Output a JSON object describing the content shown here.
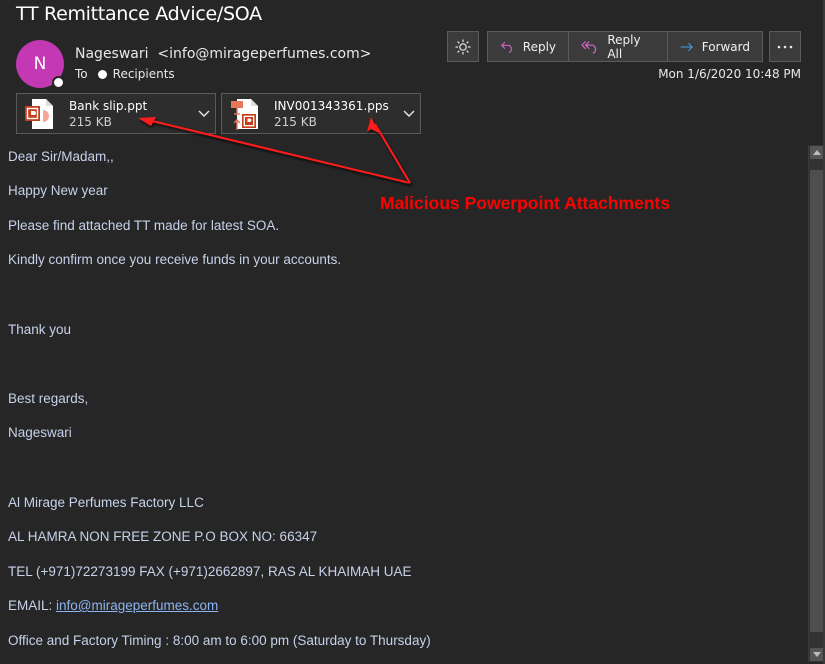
{
  "email": {
    "subject": "TT Remittance Advice/SOA",
    "avatar_initial": "N",
    "sender_display": "Nageswari  <info@mirageperfumes.com>",
    "to_label": "To",
    "recipients_label": "Recipients",
    "date": "Mon 1/6/2020 10:48 PM"
  },
  "toolbar": {
    "theme_icon": "sun-icon",
    "reply_label": "Reply",
    "reply_all_label": "Reply All",
    "forward_label": "Forward",
    "more_icon": "more-icon",
    "colors": {
      "reply_arrow": "#d269c8",
      "forward_arrow": "#4aa0e6"
    }
  },
  "attachments": [
    {
      "name": "Bank slip.ppt",
      "size": "215 KB",
      "icon": "powerpoint-file-icon"
    },
    {
      "name": "INV001343361.pps",
      "size": "215 KB",
      "icon": "powerpoint-show-file-icon"
    }
  ],
  "body": {
    "lines": [
      "Dear Sir/Madam,,",
      "Happy New year",
      "Please find attached TT made for latest SOA.",
      "Kindly confirm once you receive funds in your accounts.",
      "Thank you",
      "Best regards,",
      "Nageswari",
      "Al Mirage Perfumes Factory LLC",
      "AL HAMRA NON FREE ZONE P.O BOX NO: 66347",
      "TEL (+971)72273199 FAX (+971)2662897, RAS AL KHAIMAH UAE"
    ],
    "email_label": "EMAIL: ",
    "email_link": "info@mirageperfumes.com",
    "timing": "Office and Factory Timing : 8:00 am to 6:00 pm (Saturday to Thursday)"
  },
  "annotation": {
    "text": "Malicious Powerpoint Attachments",
    "color": "#ff0000"
  }
}
